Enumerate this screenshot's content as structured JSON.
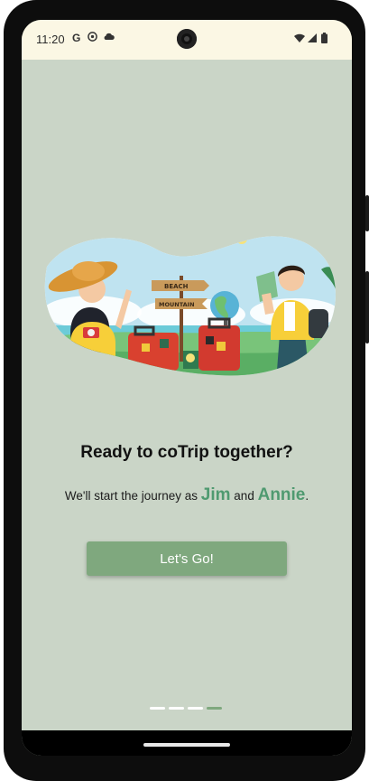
{
  "status_bar": {
    "time": "11:20",
    "left_icons": [
      "google-icon",
      "github-icon",
      "cloud-icon"
    ],
    "right_icons": [
      "wifi-icon",
      "signal-icon",
      "battery-icon"
    ]
  },
  "illustration": {
    "signs": [
      "BEACH",
      "MOUNTAIN"
    ]
  },
  "onboarding": {
    "title": "Ready to coTrip together?",
    "subtitle_prefix": "We'll start the journey as",
    "name_a": "Jim",
    "connector": "and",
    "name_b": "Annie",
    "subtitle_suffix": ".",
    "button_label": "Let's Go!"
  },
  "pager": {
    "total": 4,
    "active_index": 3
  },
  "colors": {
    "background": "#cad5c7",
    "accent": "#7fa87e",
    "name_highlight": "#4f9a70",
    "status_bar": "#fbf7e4"
  }
}
